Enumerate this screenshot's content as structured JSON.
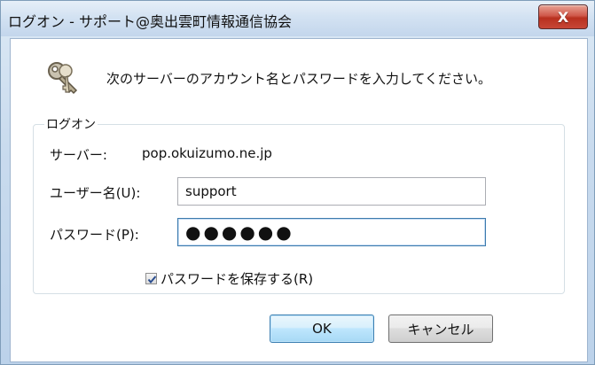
{
  "window": {
    "title": "ログオン - サポート@奥出雲町情報通信協会",
    "close_glyph": "X"
  },
  "dialog": {
    "prompt": "次のサーバーのアカウント名とパスワードを入力してください。",
    "key_icon": "key-icon",
    "group_label": "ログオン",
    "server_label": "サーバー:",
    "server_value": "pop.okuizumo.ne.jp",
    "username_label": "ユーザー名(U):",
    "username_value": "support",
    "password_label": "パスワード(P):",
    "password_masked": "●●●●●●",
    "remember_label": "パスワードを保存する(R)",
    "remember_checked": true,
    "ok_label": "OK",
    "cancel_label": "キャンセル"
  }
}
